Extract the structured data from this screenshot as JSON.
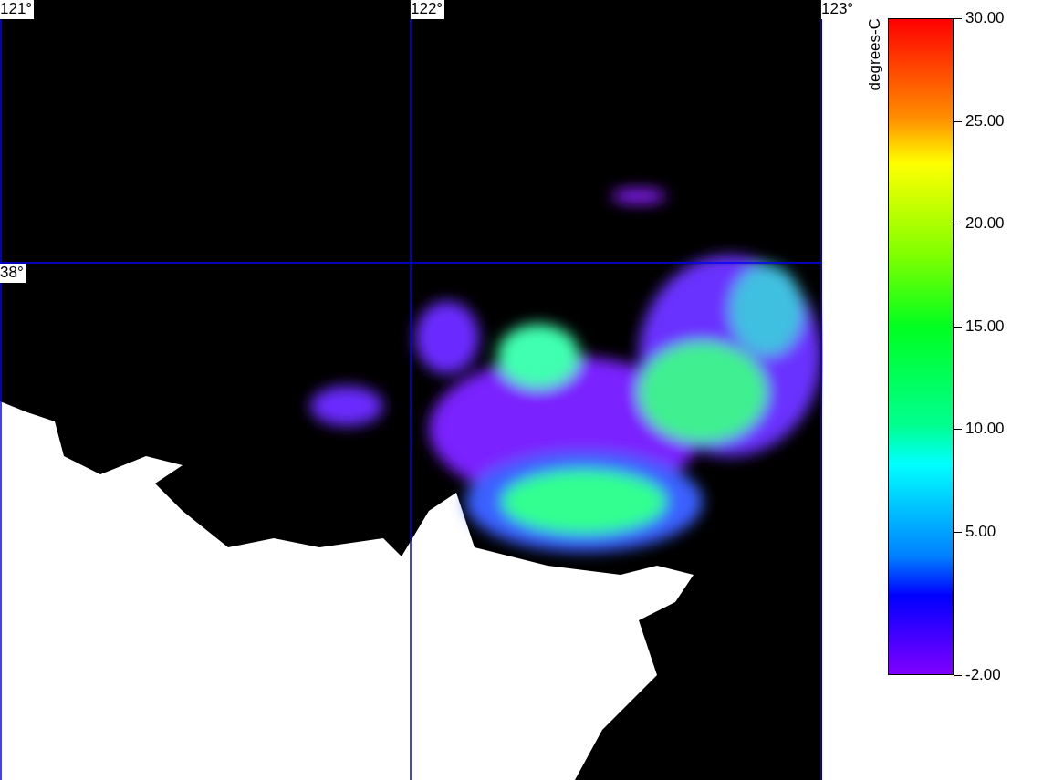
{
  "map": {
    "longitude_labels": [
      "121°",
      "122°",
      "123°"
    ],
    "latitude_labels": [
      "38°"
    ]
  },
  "legend": {
    "unit": "degrees-C",
    "ticks": [
      "30.00",
      "25.00",
      "20.00",
      "15.00",
      "10.00",
      "5.00",
      "-2.00"
    ]
  }
}
